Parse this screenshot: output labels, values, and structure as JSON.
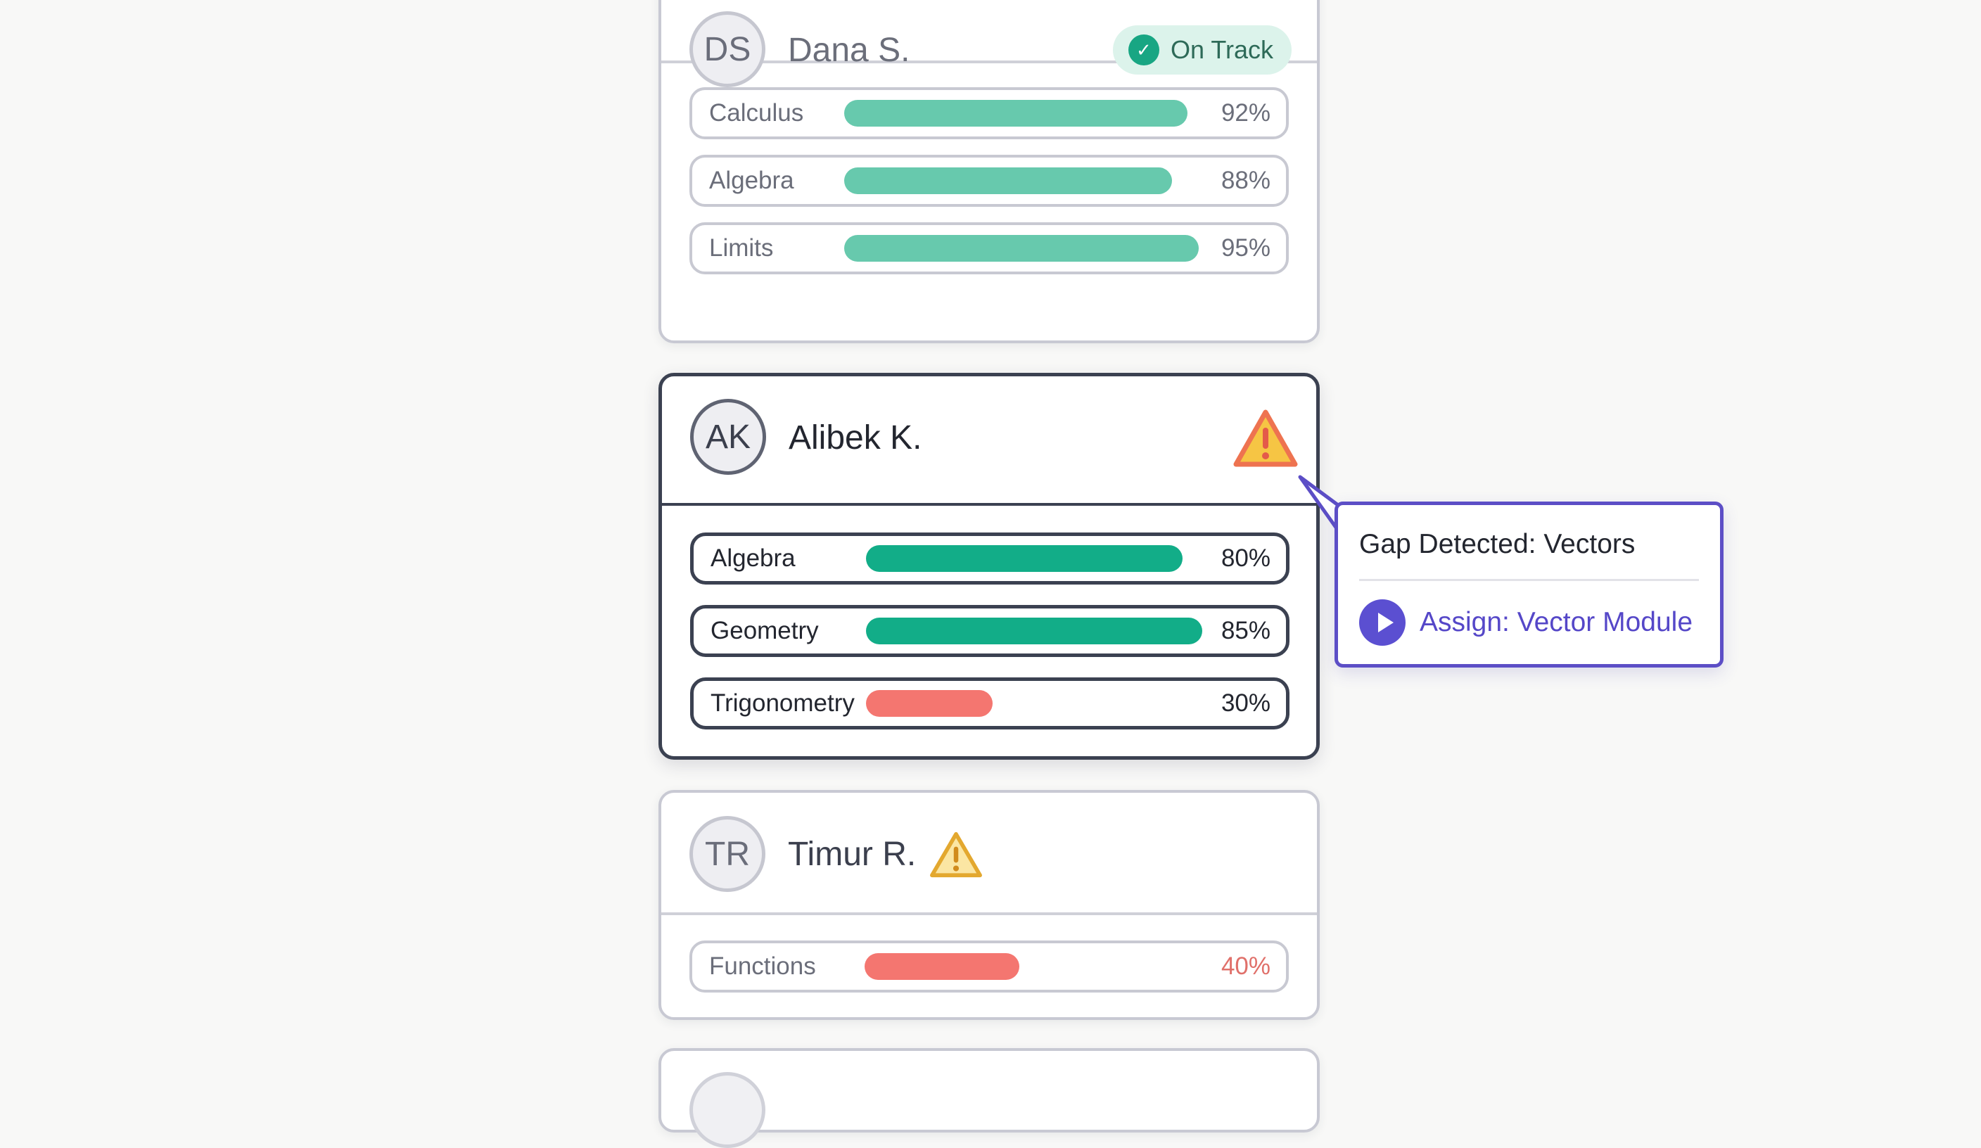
{
  "students": [
    {
      "initials": "DS",
      "name": "Dana S.",
      "status": {
        "label": "On Track",
        "icon": "check-circle-icon",
        "color": "#18a683"
      },
      "subjects": [
        {
          "name": "Calculus",
          "percent": "92%",
          "value": 0.92
        },
        {
          "name": "Algebra",
          "percent": "88%",
          "value": 0.88
        },
        {
          "name": "Limits",
          "percent": "95%",
          "value": 0.95
        }
      ]
    },
    {
      "initials": "AK",
      "name": "Alibek K.",
      "status": {
        "icon": "warning-icon",
        "color": "#f6c544"
      },
      "subjects": [
        {
          "name": "Algebra",
          "percent": "80%",
          "value": 0.8
        },
        {
          "name": "Geometry",
          "percent": "85%",
          "value": 0.85
        },
        {
          "name": "Trigonometry",
          "percent": "30%",
          "value": 0.3
        }
      ]
    },
    {
      "initials": "TR",
      "name": "Timur R.",
      "status": {
        "icon": "warning-icon",
        "color": "#f6c544"
      },
      "subjects": [
        {
          "name": "Functions",
          "percent": "40%",
          "value": 0.4
        }
      ]
    }
  ],
  "tooltip": {
    "title": "Gap Detected: Vectors",
    "action_label": "Assign: Vector Module",
    "action_icon": "play-icon",
    "accent": "#5c4ec6"
  },
  "colors": {
    "on_track_bar": "#67c9ad",
    "good_bar": "#12ad88",
    "gap_bar": "#f47670",
    "gap_text": "#e0706a"
  }
}
